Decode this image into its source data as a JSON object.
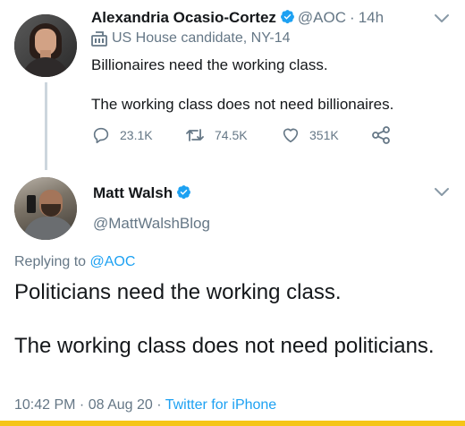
{
  "tweet1": {
    "name": "Alexandria Ocasio-Cortez",
    "handle": "@AOC",
    "separator": "·",
    "time": "14h",
    "label": "US House candidate, NY-14",
    "text_line1": "Billionaires need the working class.",
    "text_line2": "The working class does not need billionaires.",
    "replies": "23.1K",
    "retweets": "74.5K",
    "likes": "351K"
  },
  "tweet2": {
    "name": "Matt Walsh",
    "handle": "@MattWalshBlog",
    "replying_prefix": "Replying to",
    "replying_to": "@AOC",
    "text_line1": "Politicians need the working class.",
    "text_line2": "The working class does not need politicians.",
    "timestamp": "10:42 PM · 08 Aug 20 ·",
    "source": "Twitter for iPhone"
  },
  "colors": {
    "accent": "#1da1f2",
    "secondary_text": "#657786",
    "primary_text": "#14171a",
    "thread_line": "#ccd6dd",
    "bottom_bar": "#f5c518"
  },
  "icons": {
    "verified": "verified-badge-icon",
    "label": "government-building-icon",
    "reply": "reply-icon",
    "retweet": "retweet-icon",
    "like": "heart-icon",
    "share": "share-icon",
    "more": "chevron-down-icon"
  }
}
